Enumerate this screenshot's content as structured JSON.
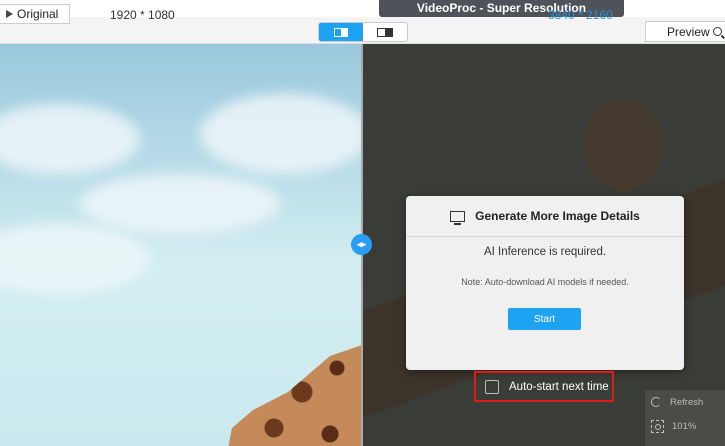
{
  "app": {
    "title": "VideoProc  -  Super Resolution"
  },
  "toolbar": {
    "original_label": "Original",
    "original_resolution": "1920 * 1080",
    "output_resolution": "3840 * 2160",
    "preview_label": "Preview"
  },
  "dialog": {
    "title": "Generate More Image Details",
    "message": "AI Inference is required.",
    "note": "Note: Auto-download AI models if needed.",
    "start_label": "Start"
  },
  "autostart": {
    "label": "Auto-start next time",
    "checked": false
  },
  "side_panel": {
    "refresh_label": "Refresh",
    "zoom_label": "101%"
  },
  "colors": {
    "accent": "#1ea2f2",
    "highlight_border": "#e11919"
  }
}
